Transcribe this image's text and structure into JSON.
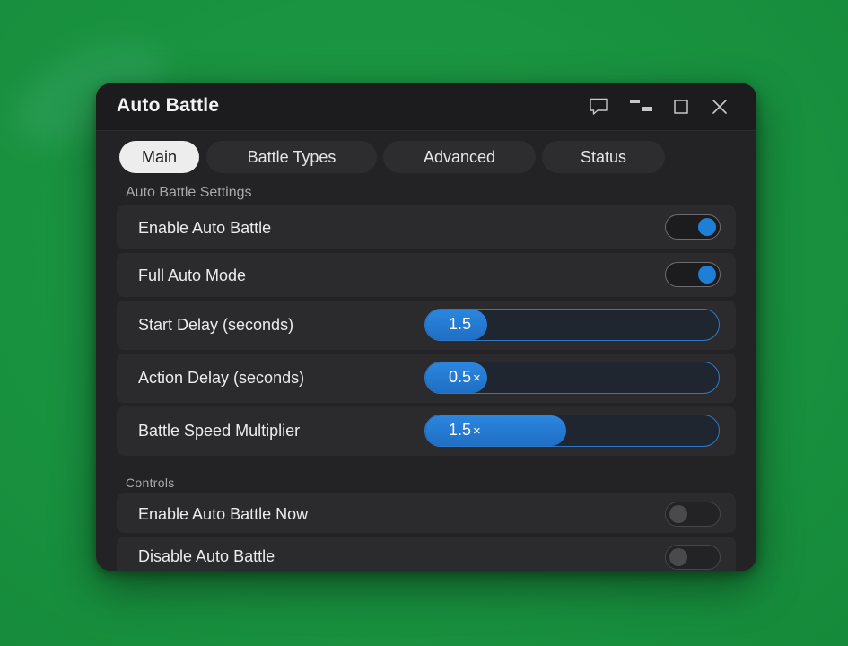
{
  "window": {
    "title": "Auto Battle"
  },
  "titlebar_icons": [
    "chat-icon",
    "snap-layout-icon",
    "maximize-icon",
    "close-icon"
  ],
  "tabs": [
    {
      "label": "Main",
      "active": true
    },
    {
      "label": "Battle Types",
      "active": false
    },
    {
      "label": "Advanced",
      "active": false
    },
    {
      "label": "Status",
      "active": false
    }
  ],
  "settings": {
    "section_title": "Auto Battle Settings",
    "enable_auto_battle": {
      "label": "Enable Auto Battle",
      "on": true
    },
    "full_auto_mode": {
      "label": "Full Auto Mode",
      "on": true
    },
    "start_delay": {
      "label": "Start Delay (seconds)",
      "value": "1.5",
      "suffix": "",
      "level": 0.21
    },
    "action_delay": {
      "label": "Action Delay (seconds)",
      "value": "0.5",
      "suffix": "×",
      "level": 0.21
    },
    "battle_speed": {
      "label": "Battle Speed Multiplier",
      "value": "1.5",
      "suffix": "×",
      "level": 0.48
    }
  },
  "controls": {
    "section_title": "Controls",
    "enable_now": {
      "label": "Enable Auto Battle Now",
      "on": false
    },
    "disable": {
      "label": "Disable Auto Battle",
      "on": false
    }
  },
  "colors": {
    "accent": "#1f7ed6",
    "background": "#1a9441",
    "window": "#232325"
  }
}
